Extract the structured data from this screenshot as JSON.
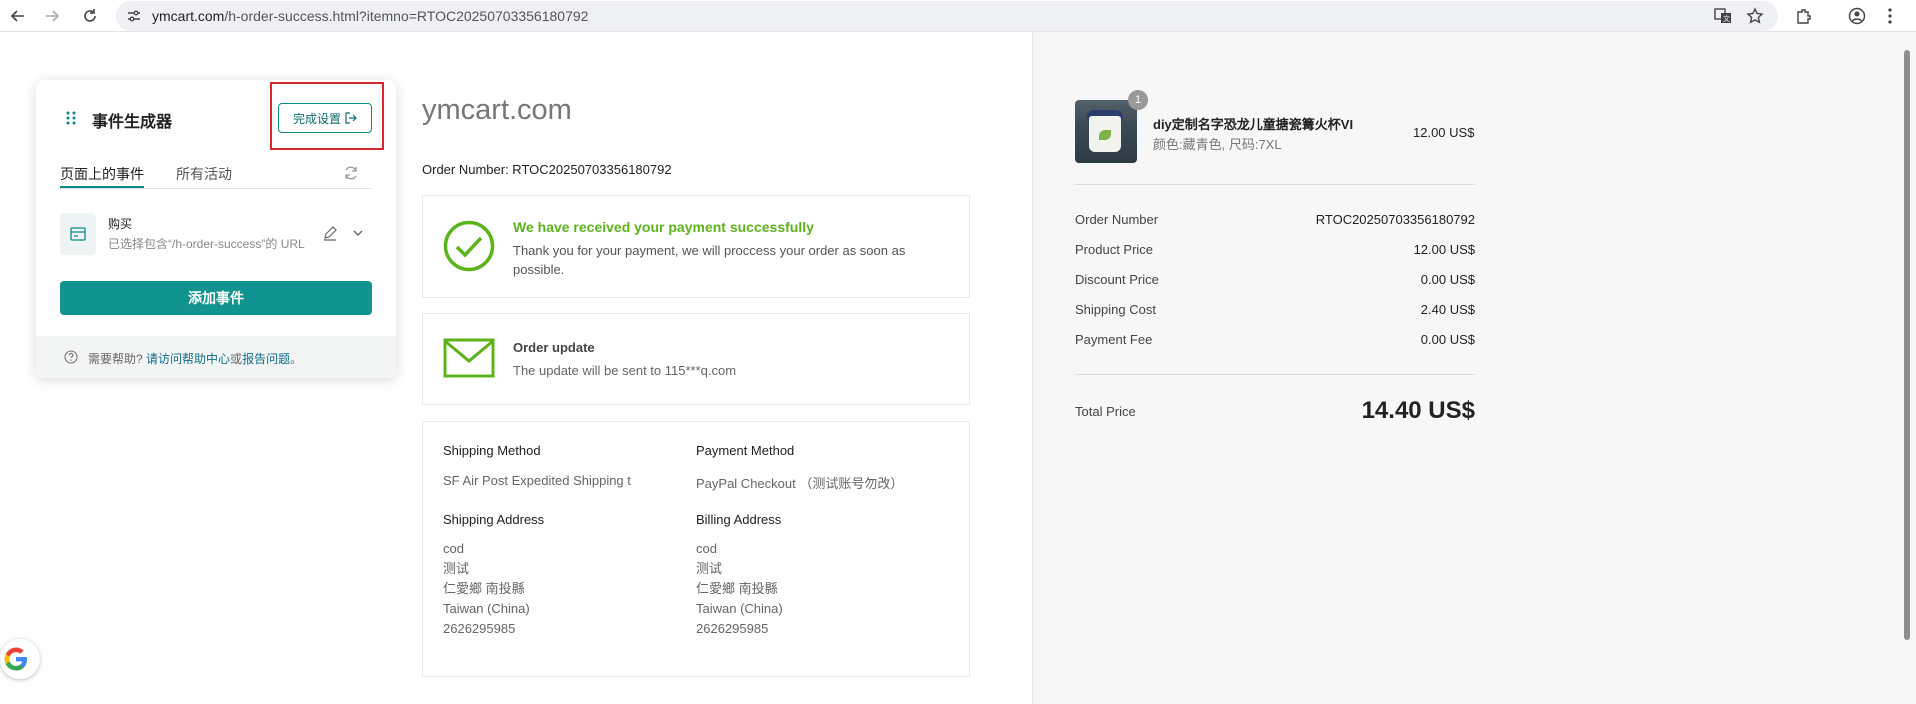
{
  "browser": {
    "url_host": "ymcart.com",
    "url_path": "/h-order-success.html?itemno=RTOC20250703356180792"
  },
  "event_builder": {
    "title": "事件生成器",
    "done_label": "完成设置",
    "tabs": [
      {
        "label": "页面上的事件"
      },
      {
        "label": "所有活动"
      }
    ],
    "event": {
      "name": "购买",
      "description": "已选择包含“/h-order-success”的 URL"
    },
    "add_label": "添加事件",
    "help": {
      "prefix": "需要帮助?",
      "link1": "请访问帮助中心",
      "middle": "或",
      "link2": "报告问题",
      "suffix": "。"
    }
  },
  "site": {
    "title": "ymcart.com",
    "order_number_line": "Order Number: RTOC20250703356180792"
  },
  "payment_card": {
    "title": "We have received your payment successfully",
    "text": "Thank you for your payment, we will proccess your order as soon as possible."
  },
  "update_card": {
    "title": "Order update",
    "text": "The update will be sent to 115***q.com"
  },
  "details": {
    "shipping_method_label": "Shipping Method",
    "shipping_method_value": "SF Air Post Expedited Shipping t",
    "payment_method_label": "Payment Method",
    "payment_method_value": "PayPal Checkout （测试账号勿改）",
    "shipping_address_label": "Shipping Address",
    "billing_address_label": "Billing Address",
    "shipping_address": [
      "cod",
      "测试",
      "仁愛鄉 南投縣",
      "Taiwan (China)",
      "2626295985"
    ],
    "billing_address": [
      "cod",
      "测试",
      "仁愛鄉 南投縣",
      "Taiwan (China)",
      "2626295985"
    ]
  },
  "summary": {
    "product": {
      "qty": "1",
      "name": "diy定制名字恐龙儿童搪瓷篝火杯VI",
      "variant": "颜色:藏青色, 尺码:7XL",
      "price": "12.00 US$"
    },
    "rows": [
      {
        "label": "Order Number",
        "value": "RTOC20250703356180792"
      },
      {
        "label": "Product Price",
        "value": "12.00 US$"
      },
      {
        "label": "Discount Price",
        "value": "0.00 US$"
      },
      {
        "label": "Shipping Cost",
        "value": "2.40 US$"
      },
      {
        "label": "Payment Fee",
        "value": "0.00 US$"
      }
    ],
    "total_label": "Total Price",
    "total_value": "14.40 US$"
  },
  "colors": {
    "accent": "#11948f",
    "success": "#5cb41a",
    "highlight": "#d9262b"
  }
}
